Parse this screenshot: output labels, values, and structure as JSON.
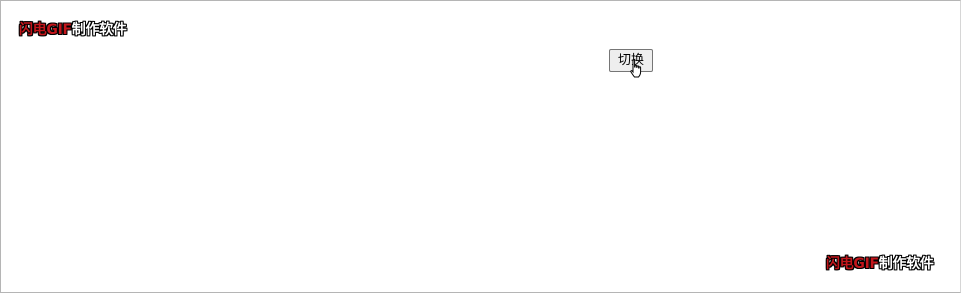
{
  "watermarks": {
    "top": {
      "brand": "闪电GIF",
      "rest": "制作软件"
    },
    "bottom": {
      "brand": "闪电GIF",
      "rest": "制作软件"
    }
  },
  "toggle_button": {
    "label": "切换"
  },
  "colors": {
    "brand_red": "#c4161c",
    "button_bg": "#eeeeee",
    "button_border": "#767676"
  },
  "icons": {
    "cursor": "hand-pointer-cursor-icon"
  }
}
